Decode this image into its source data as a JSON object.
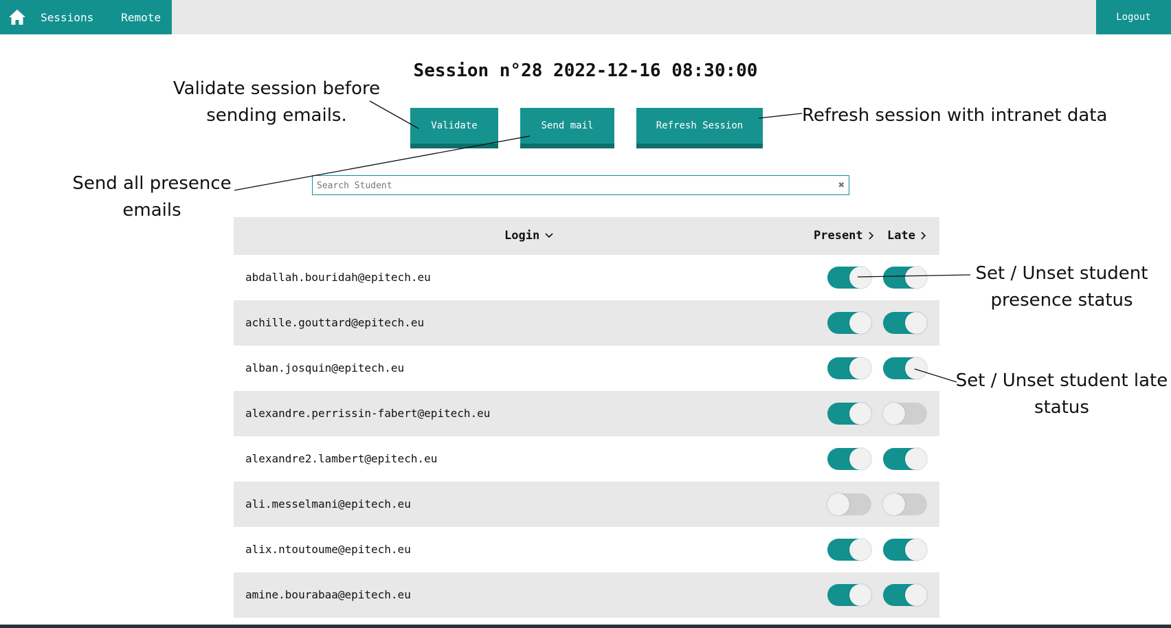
{
  "nav": {
    "sessions": "Sessions",
    "remote": "Remote",
    "logout": "Logout"
  },
  "page": {
    "title": "Session n°28 2022-12-16 08:30:00"
  },
  "actions": {
    "validate": "Validate",
    "send_mail": "Send mail",
    "refresh": "Refresh Session"
  },
  "search": {
    "placeholder": "Search Student",
    "value": ""
  },
  "table": {
    "headers": {
      "login": "Login",
      "present": "Present",
      "late": "Late"
    },
    "rows": [
      {
        "login": "abdallah.bouridah@epitech.eu",
        "present": true,
        "late": true
      },
      {
        "login": "achille.gouttard@epitech.eu",
        "present": true,
        "late": true
      },
      {
        "login": "alban.josquin@epitech.eu",
        "present": true,
        "late": true
      },
      {
        "login": "alexandre.perrissin-fabert@epitech.eu",
        "present": true,
        "late": false
      },
      {
        "login": "alexandre2.lambert@epitech.eu",
        "present": true,
        "late": true
      },
      {
        "login": "ali.messelmani@epitech.eu",
        "present": false,
        "late": false
      },
      {
        "login": "alix.ntoutoume@epitech.eu",
        "present": true,
        "late": true
      },
      {
        "login": "amine.bourabaa@epitech.eu",
        "present": true,
        "late": true
      }
    ]
  },
  "annotations": {
    "validate_l1": "Validate session before",
    "validate_l2": "sending emails.",
    "refresh": "Refresh session with intranet data",
    "send_l1": "Send all presence",
    "send_l2": "emails",
    "presence_l1": "Set / Unset student",
    "presence_l2": "presence status",
    "late_l1": "Set / Unset student late",
    "late_l2": "status"
  },
  "colors": {
    "accent": "#12918f",
    "toggle_off": "#cfcfcf",
    "row_alt": "#e8e8e8"
  },
  "icons": {
    "home": "home-icon",
    "clear": "close-icon",
    "sort": "chevron-down-icon",
    "next": "chevron-right-icon"
  }
}
